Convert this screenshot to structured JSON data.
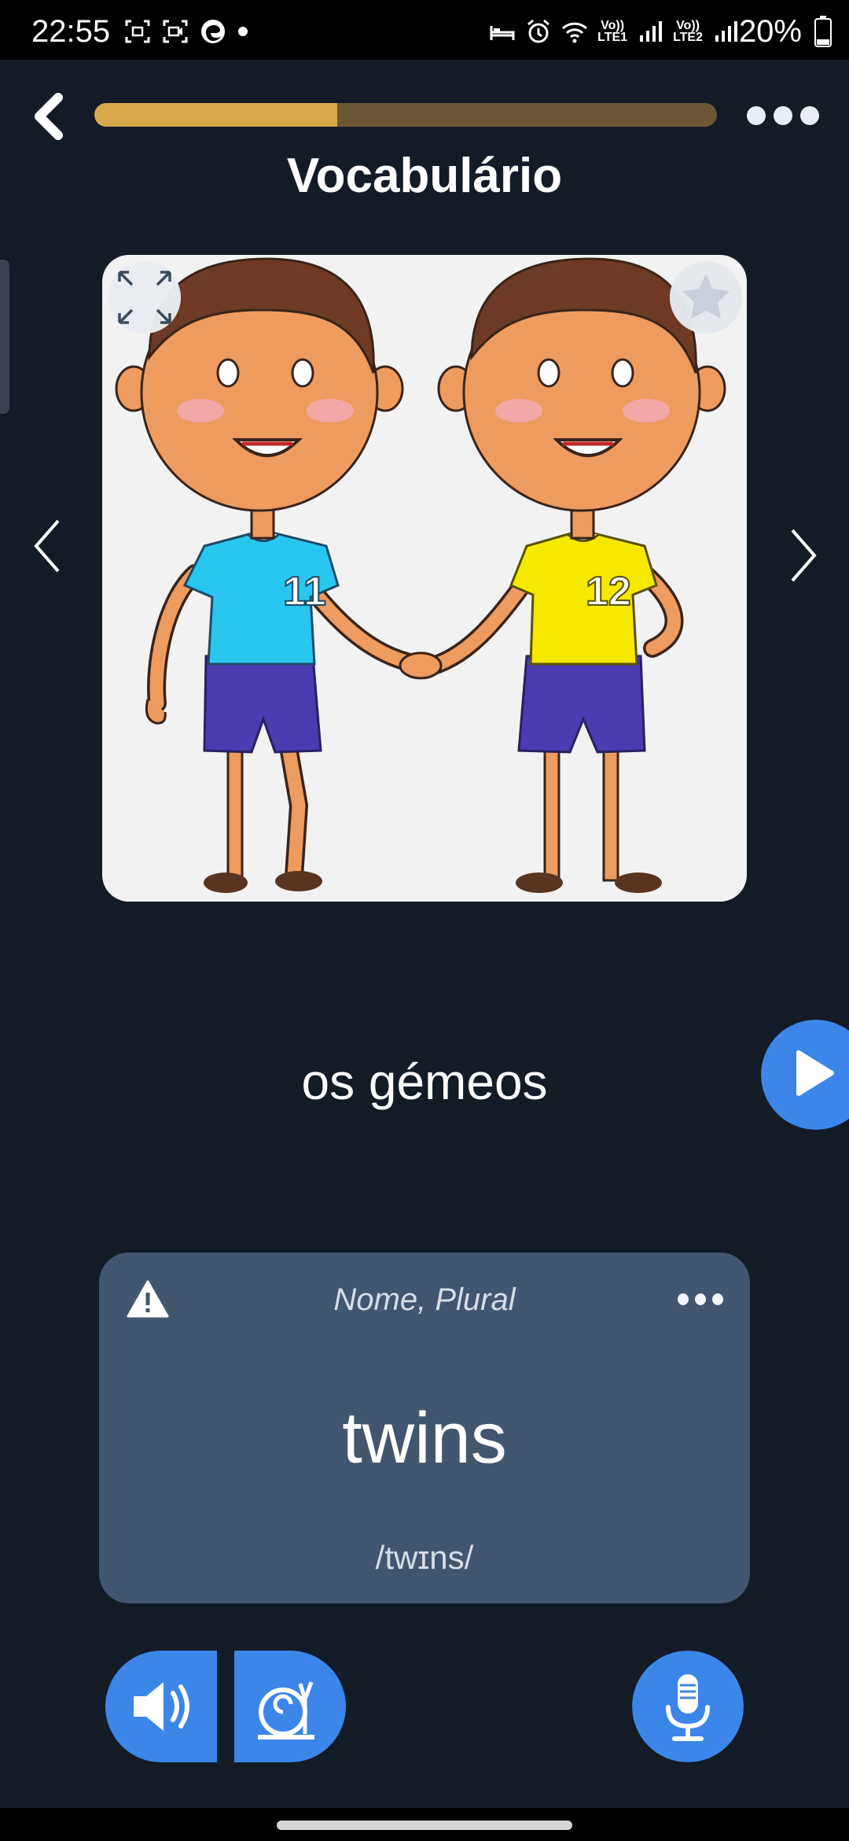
{
  "status_bar": {
    "time": "22:55",
    "net1": "Vo))\nLTE1",
    "net2": "Vo))\nLTE2",
    "battery": "20%"
  },
  "header": {
    "title": "Vocabulário",
    "progress_fraction": 0.39
  },
  "card": {
    "image_icon": "twins-cartoon",
    "shirt_left": "11",
    "shirt_right": "12",
    "colors": {
      "shirt_left": "#29c6f0",
      "shirt_right": "#f7e800",
      "shorts": "#4a3bb0",
      "skin": "#ee9b5f"
    }
  },
  "word": "os gémeos",
  "translation_card": {
    "part_of_speech": "Nome, Plural",
    "translation": "twins",
    "ipa": "/twɪns/"
  },
  "colors": {
    "accent": "#3b86e8",
    "progress_fill": "#d9a84a",
    "progress_track": "#6b5635",
    "background": "#131b27",
    "card": "#43566f"
  }
}
